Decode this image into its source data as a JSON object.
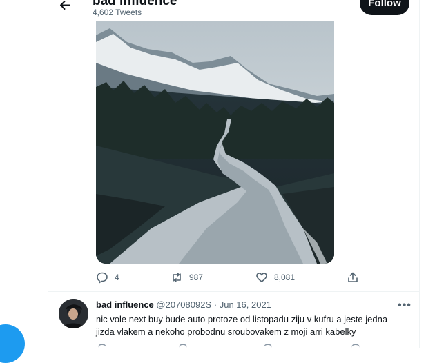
{
  "header": {
    "back_icon": "arrow-left-icon",
    "title": "bad influence",
    "subtitle": "4,602 Tweets",
    "follow_label": "Follow"
  },
  "tweet": {
    "image_description_icon": "mountain-road-photo",
    "actions": {
      "reply_icon": "reply-icon",
      "reply_count": "4",
      "retweet_icon": "retweet-icon",
      "retweet_count": "987",
      "like_icon": "heart-icon",
      "like_count": "8,081",
      "share_icon": "share-icon"
    }
  },
  "reply": {
    "name": "bad influence",
    "handle": "@20708092S",
    "separator": "·",
    "date": "Jun 16, 2021",
    "more_icon": "more-icon",
    "more": "•••",
    "text": "nic vole next buy bude auto protoze od listopadu ziju v kufru a jeste jedna jizda vlakem a nekoho probodnu sroubovakem z moji arri kabelky"
  },
  "colors": {
    "text_primary": "#0f1419",
    "text_secondary": "#536471",
    "accent": "#1d9bf0",
    "border": "#eff3f4"
  }
}
